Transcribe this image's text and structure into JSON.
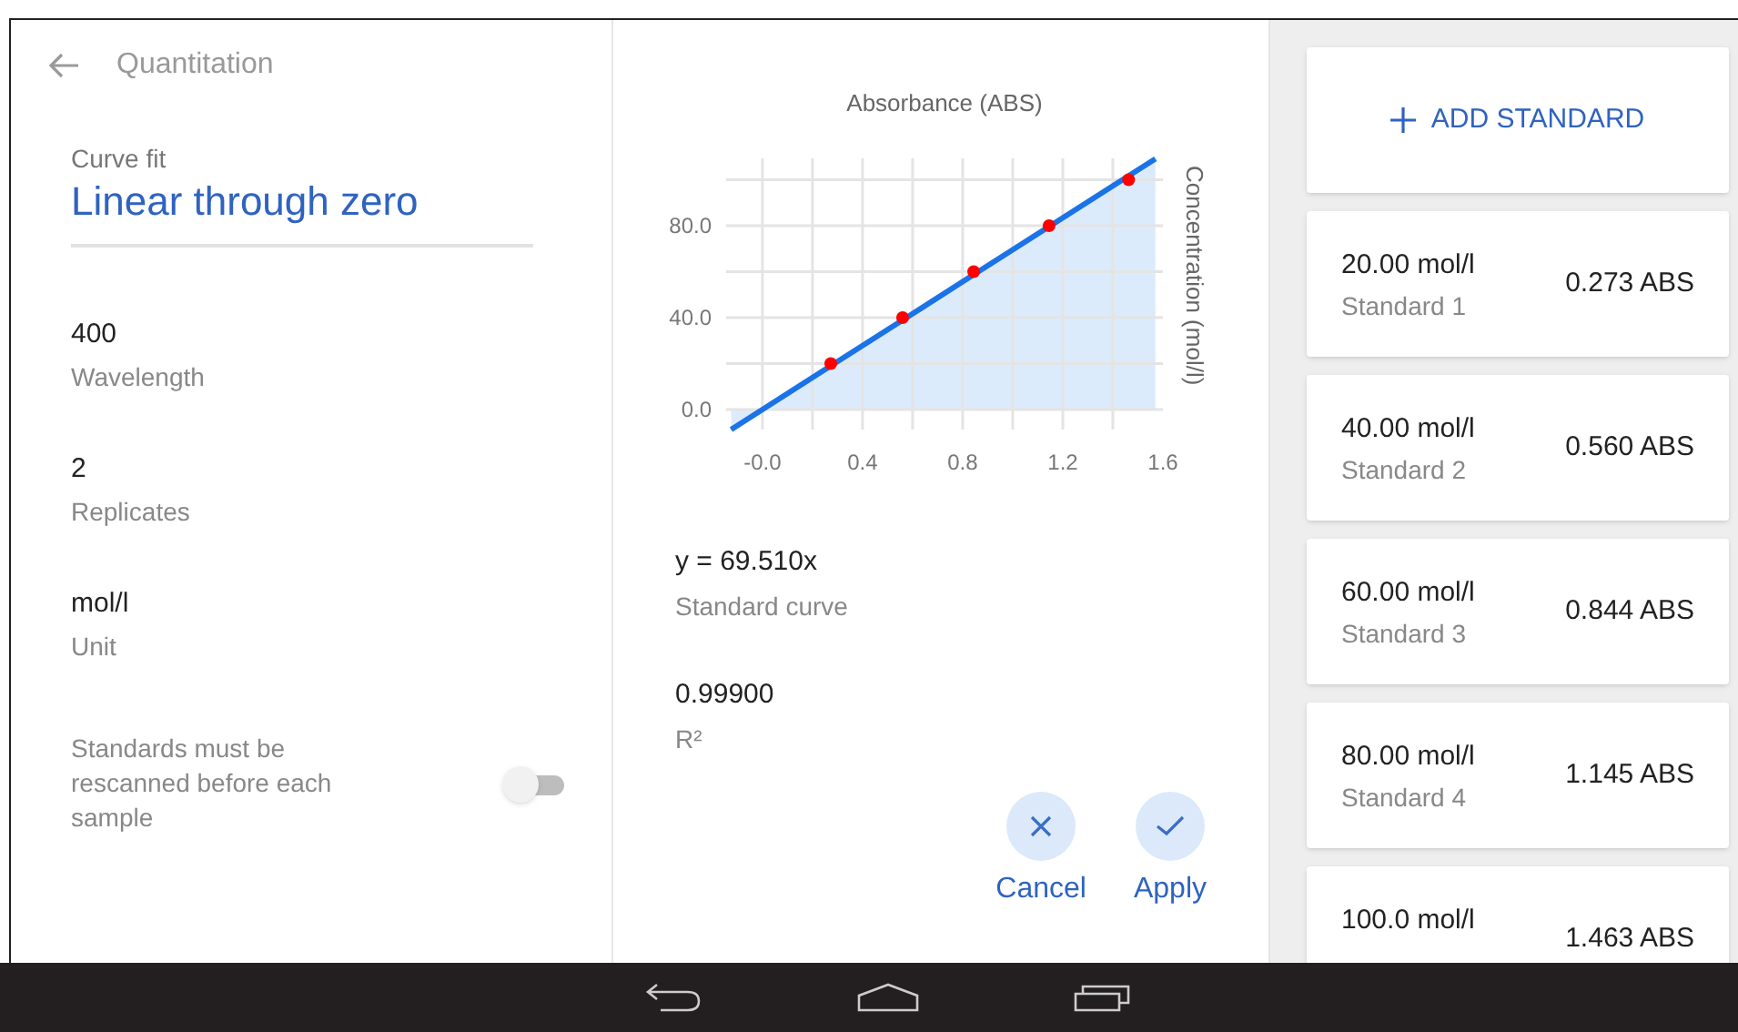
{
  "header": {
    "title": "Quantitation"
  },
  "curve_fit": {
    "label": "Curve fit",
    "value": "Linear through zero"
  },
  "settings": [
    {
      "value": "400",
      "label": "Wavelength"
    },
    {
      "value": "2",
      "label": "Replicates"
    },
    {
      "value": "mol/l",
      "label": "Unit"
    }
  ],
  "rescan_toggle": {
    "label": "Standards must be rescanned before each sample",
    "on": false
  },
  "chart": {
    "chart_data": {
      "type": "area",
      "grid": true,
      "xlabel": "Absorbance (ABS)",
      "ylabel": "Concentration (mol/l)",
      "x": [
        -0.125,
        0.273,
        0.56,
        0.844,
        1.145,
        1.463,
        1.57
      ],
      "series": [
        {
          "color": "#1a73e8",
          "values": [
            -8.7,
            19,
            38.9,
            58.7,
            79.6,
            101.7,
            109.1
          ]
        },
        {
          "type": "scatter",
          "color": "#ff0000",
          "values": [
            null,
            20,
            40,
            60,
            80,
            100,
            null
          ]
        }
      ],
      "xlim": [
        -0.145,
        1.6
      ],
      "ylim": [
        -8.7,
        109.3
      ],
      "xticks": [
        {
          "value": 0,
          "label": "-0.0"
        },
        {
          "value": 0.4,
          "label": "0.4"
        },
        {
          "value": 0.8,
          "label": "0.8"
        },
        {
          "value": 1.2,
          "label": "1.2"
        },
        {
          "value": 1.6,
          "label": "1.6"
        }
      ],
      "yticks": [
        {
          "value": 0,
          "label": "0.0"
        },
        {
          "value": 40,
          "label": "40.0"
        },
        {
          "value": 80,
          "label": "80.0"
        }
      ]
    }
  },
  "results": [
    {
      "value": "y = 69.510x",
      "label": "Standard curve"
    },
    {
      "value": "0.99900",
      "label": "R²"
    }
  ],
  "actions": [
    {
      "kind": "cancel",
      "label": "Cancel"
    },
    {
      "kind": "apply",
      "label": "Apply"
    }
  ],
  "add_button": {
    "label": "ADD STANDARD"
  },
  "standards": [
    {
      "concentration": "20.00 mol/l",
      "name": "Standard 1",
      "absorbance": "0.273 ABS"
    },
    {
      "concentration": "40.00 mol/l",
      "name": "Standard 2",
      "absorbance": "0.560 ABS"
    },
    {
      "concentration": "60.00 mol/l",
      "name": "Standard 3",
      "absorbance": "0.844 ABS"
    },
    {
      "concentration": "80.00 mol/l",
      "name": "Standard 4",
      "absorbance": "1.145 ABS"
    },
    {
      "concentration": "100.0 mol/l",
      "absorbance": "1.463 ABS"
    }
  ]
}
